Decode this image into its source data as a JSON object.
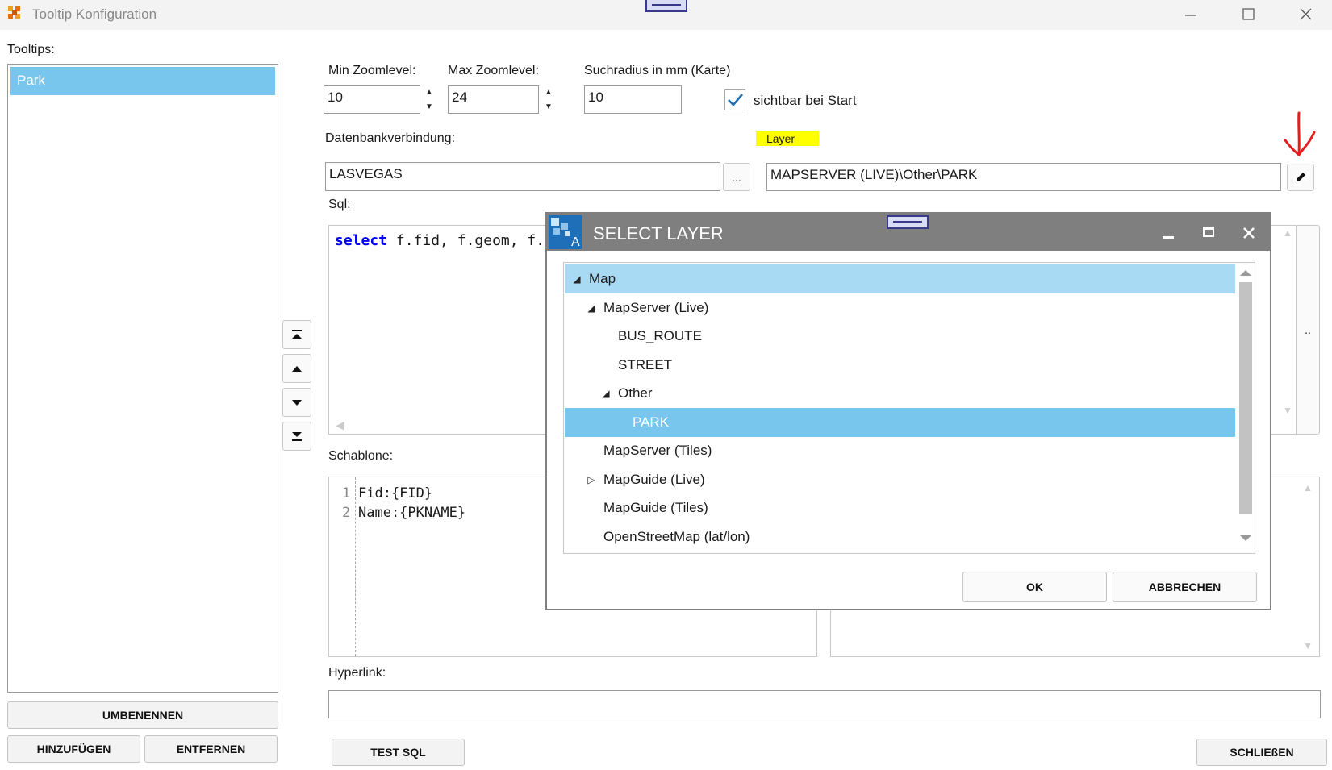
{
  "window": {
    "title": "Tooltip Konfiguration"
  },
  "left": {
    "label": "Tooltips:",
    "items": [
      {
        "label": "Park"
      }
    ],
    "rename_label": "UMBENENNEN",
    "add_label": "HINZUFÜGEN",
    "remove_label": "ENTFERNEN"
  },
  "form": {
    "min_zoom_label": "Min Zoomlevel:",
    "min_zoom_value": "10",
    "max_zoom_label": "Max Zoomlevel:",
    "max_zoom_value": "24",
    "radius_label": "Suchradius in mm (Karte)",
    "radius_value": "10",
    "visible_label": "sichtbar bei Start",
    "db_label": "Datenbankverbindung:",
    "db_value": "LASVEGAS",
    "browse_label": "...",
    "layer_label": "Layer",
    "layer_value": "MAPSERVER (LIVE)\\Other\\PARK",
    "sql_label": "Sql:",
    "sql_keyword": "select",
    "sql_rest": " f.fid, f.geom, f.",
    "template_label": "Schablone:",
    "template_lines": [
      {
        "num": "1",
        "text": "Fid:{FID}"
      },
      {
        "num": "2",
        "text": "Name:{PKNAME}"
      }
    ],
    "hyperlink_label": "Hyperlink:",
    "hyperlink_value": "",
    "test_sql_label": "TEST SQL",
    "close_label": "SCHLIEßEN",
    "side_dots": ".."
  },
  "dialog": {
    "title": "SELECT LAYER",
    "tree": [
      {
        "label": "Map",
        "level": 0,
        "expanded": true,
        "state": "highlight"
      },
      {
        "label": "MapServer (Live)",
        "level": 1,
        "expanded": true
      },
      {
        "label": "BUS_ROUTE",
        "level": 2
      },
      {
        "label": "STREET",
        "level": 2
      },
      {
        "label": "Other",
        "level": 2,
        "expanded": true
      },
      {
        "label": "PARK",
        "level": 3,
        "state": "selected"
      },
      {
        "label": "MapServer (Tiles)",
        "level": 1
      },
      {
        "label": "MapGuide (Live)",
        "level": 1,
        "expanded": false
      },
      {
        "label": "MapGuide (Tiles)",
        "level": 1
      },
      {
        "label": "OpenStreetMap (lat/lon)",
        "level": 1
      }
    ],
    "ok_label": "OK",
    "cancel_label": "ABBRECHEN"
  },
  "colors": {
    "selection": "#78c6ee",
    "highlight": "#a8dbf3",
    "layer_highlight": "#ffff00",
    "annotation_red": "#e02020",
    "sql_keyword": "#0000ff",
    "dialog_titlebar": "#7f7f7f"
  }
}
